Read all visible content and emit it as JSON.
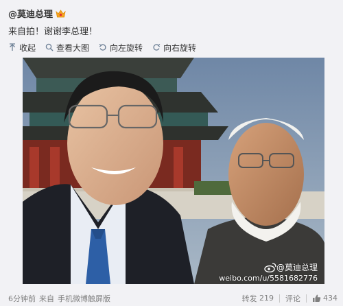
{
  "post": {
    "author": "@莫迪总理",
    "text": "来自拍！谢谢李总理！",
    "time": "6分钟前",
    "source_prefix": "来自",
    "source": "手机微博触屏版"
  },
  "toolbar": {
    "collapse_label": "收起",
    "view_large_label": "查看大图",
    "rotate_left_label": "向左旋转",
    "rotate_right_label": "向右旋转"
  },
  "watermark": {
    "handle": "@莫迪总理",
    "url": "weibo.com/u/5581682776"
  },
  "stats": {
    "repost_label": "转发",
    "repost_count": "219",
    "comment_label": "评论",
    "like_count": "434"
  },
  "colors": {
    "link": "#333333",
    "meta": "#808080",
    "background": "#f2f2f5",
    "badge": "#f5a623"
  },
  "icons": {
    "collapse": "collapse-up-arrow-icon",
    "view_large": "magnifier-icon",
    "rotate_left": "rotate-left-icon",
    "rotate_right": "rotate-right-icon",
    "like": "thumbs-up-icon",
    "badge": "vip-badge-icon",
    "weibo": "weibo-logo-icon"
  }
}
